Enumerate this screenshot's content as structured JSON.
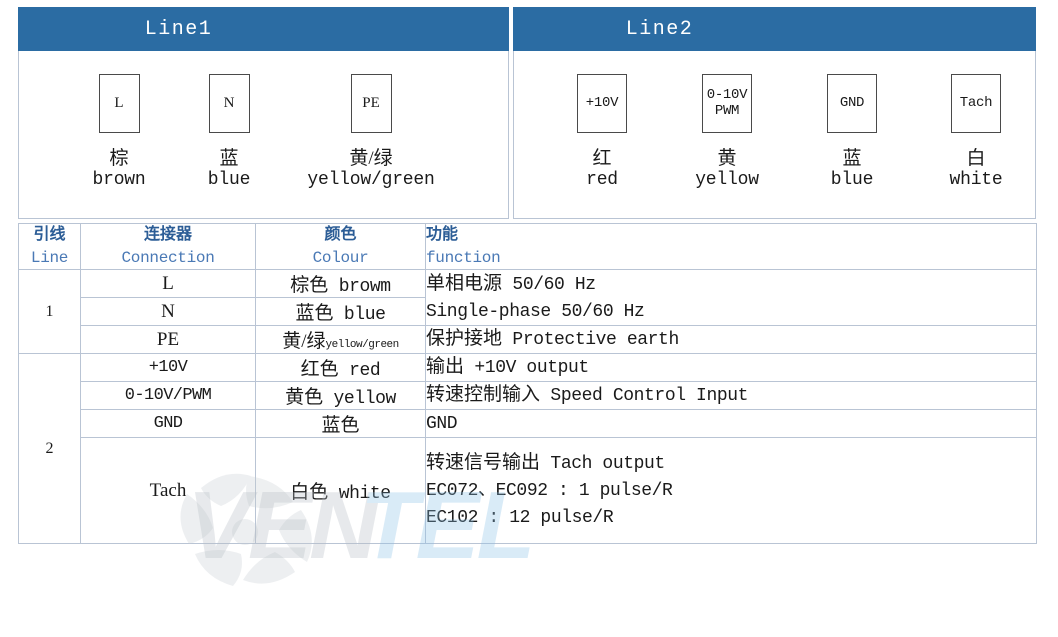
{
  "accent_blue": "#2b6ca3",
  "header_text_blue": "#2c5d96",
  "border_color": "#b9c4d4",
  "watermark": {
    "text": "VENTEL",
    "logo": "fan-impeller-logo"
  },
  "panels": [
    {
      "title": "Line1",
      "connectors": [
        {
          "box_lines": [
            "L"
          ],
          "cn": "棕",
          "en": "brown"
        },
        {
          "box_lines": [
            "N"
          ],
          "cn": "蓝",
          "en": "blue"
        },
        {
          "box_lines": [
            "PE"
          ],
          "cn": "黄/绿",
          "en": "yellow/green"
        }
      ]
    },
    {
      "title": "Line2",
      "connectors": [
        {
          "box_lines": [
            "+10V"
          ],
          "cn": "红",
          "en": "red"
        },
        {
          "box_lines": [
            "0-10V",
            "PWM"
          ],
          "cn": "黄",
          "en": "yellow"
        },
        {
          "box_lines": [
            "GND"
          ],
          "cn": "蓝",
          "en": "blue"
        },
        {
          "box_lines": [
            "Tach"
          ],
          "cn": "白",
          "en": "white"
        }
      ]
    }
  ],
  "table": {
    "headers": [
      {
        "cn": "引线",
        "en": "Line"
      },
      {
        "cn": "连接器",
        "en": "Connection"
      },
      {
        "cn": "颜色",
        "en": "Colour"
      },
      {
        "cn": "功能",
        "en": "function"
      }
    ],
    "groups": [
      {
        "line": "1",
        "rows": [
          {
            "connection": "L",
            "colour_cn": "棕色",
            "colour_en": "browm"
          },
          {
            "connection": "N",
            "colour_cn": "蓝色",
            "colour_en": "blue"
          },
          {
            "connection": "PE",
            "colour_cn": "黄/绿",
            "colour_en": "yellow/green",
            "colour_en_small": true
          }
        ],
        "functions": [
          {
            "rowspan": 2,
            "lines": [
              {
                "cjk": "单相电源",
                "rest": " 50/60 Hz"
              },
              {
                "cjk": "",
                "rest": "Single-phase 50/60 Hz"
              }
            ]
          },
          {
            "rowspan": 1,
            "lines": [
              {
                "cjk": "保护接地",
                "rest": " Protective earth"
              }
            ]
          }
        ]
      },
      {
        "line": "2",
        "rows": [
          {
            "connection": "+10V",
            "colour_cn": "红色",
            "colour_en": "red"
          },
          {
            "connection": "0-10V/PWM",
            "colour_cn": "黄色",
            "colour_en": "yellow"
          },
          {
            "connection": "GND",
            "colour_cn": "蓝色",
            "colour_en": ""
          },
          {
            "connection": "Tach",
            "colour_cn": "白色",
            "colour_en": "white"
          }
        ],
        "functions": [
          {
            "rowspan": 1,
            "lines": [
              {
                "cjk": "输出",
                "rest": " +10V output"
              }
            ]
          },
          {
            "rowspan": 1,
            "lines": [
              {
                "cjk": "转速控制输入",
                "rest": " Speed Control Input"
              }
            ]
          },
          {
            "rowspan": 1,
            "lines": [
              {
                "cjk": "",
                "rest": "GND"
              }
            ]
          },
          {
            "rowspan": 1,
            "lines": [
              {
                "cjk": "转速信号输出",
                "rest": " Tach output"
              },
              {
                "cjk": "",
                "rest": "EC072、EC092 : 1 pulse/R"
              },
              {
                "cjk": "",
                "rest": "EC102 : 12 pulse/R"
              }
            ]
          }
        ]
      }
    ]
  }
}
